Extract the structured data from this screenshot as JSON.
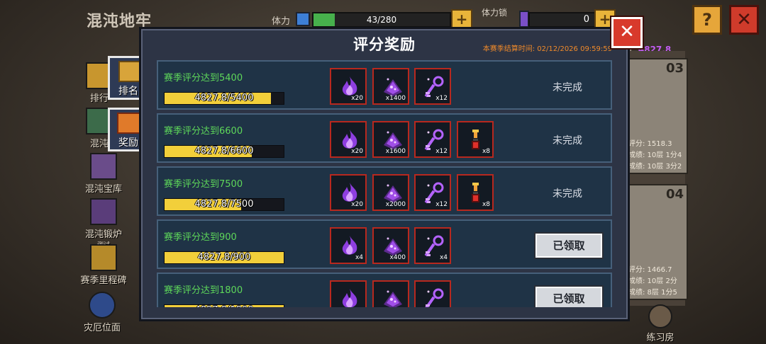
{
  "background": {
    "title": "混沌地牢",
    "stamina_label": "体力",
    "stamina_value": "43/280",
    "stamina_fraction": 0.154,
    "lock_label": "体力锁",
    "lock_value": "0",
    "help_label": "?",
    "close_label": "✕"
  },
  "sidebar": {
    "items": [
      {
        "label": "排行",
        "icon": "trophy-icon"
      },
      {
        "label": "混沌",
        "icon": "portal-icon"
      },
      {
        "label": "混沌宝库",
        "icon": "vault-icon"
      },
      {
        "label": "混沌锻炉",
        "sublabel": "测试",
        "icon": "forge-icon"
      },
      {
        "label": "赛季里程碑",
        "icon": "star-badge-icon"
      },
      {
        "label": "灾厄位面",
        "icon": "vortex-icon"
      }
    ],
    "tabs": [
      {
        "label": "排名",
        "icon": "trophy-icon"
      },
      {
        "label": "奖励",
        "icon": "treasure-chest-icon"
      }
    ]
  },
  "right_panel": {
    "score_label": "分:",
    "score_value": "4827.8",
    "cards": [
      {
        "number": "03",
        "lines": [
          "评分: 1518.3",
          "成绩: 10层 1分4",
          "成绩: 10层 3分2"
        ]
      },
      {
        "number": "04",
        "lines": [
          "评分: 1466.7",
          "成绩: 10层 2分",
          "成绩: 8层 1分5"
        ]
      }
    ],
    "practice_label": "练习房"
  },
  "modal": {
    "title": "评分奖励",
    "season_end": "本赛季结算时间: 02/12/2026 09:59:59",
    "close_label": "✕",
    "rows": [
      {
        "label": "赛季评分达到5400",
        "progress_text": "4827.8/5400",
        "progress": 0.894,
        "rewards": [
          {
            "icon": "purple-flame-icon",
            "qty": "x20"
          },
          {
            "icon": "purple-dust-pile-icon",
            "qty": "x1400"
          },
          {
            "icon": "purple-key-icon",
            "qty": "x12"
          }
        ],
        "status": "未完成",
        "claimed": false
      },
      {
        "label": "赛季评分达到6600",
        "progress_text": "4827.8/6600",
        "progress": 0.731,
        "rewards": [
          {
            "icon": "purple-flame-icon",
            "qty": "x20"
          },
          {
            "icon": "purple-dust-pile-icon",
            "qty": "x1600"
          },
          {
            "icon": "purple-key-icon",
            "qty": "x12"
          },
          {
            "icon": "torch-potion-icon",
            "qty": "x8"
          }
        ],
        "status": "未完成",
        "claimed": false
      },
      {
        "label": "赛季评分达到7500",
        "progress_text": "4827.8/7500",
        "progress": 0.644,
        "rewards": [
          {
            "icon": "purple-flame-icon",
            "qty": "x20"
          },
          {
            "icon": "purple-dust-pile-icon",
            "qty": "x2000"
          },
          {
            "icon": "purple-key-icon",
            "qty": "x12"
          },
          {
            "icon": "torch-potion-icon",
            "qty": "x8"
          }
        ],
        "status": "未完成",
        "claimed": false
      },
      {
        "label": "赛季评分达到900",
        "progress_text": "4827.8/900",
        "progress": 1.0,
        "rewards": [
          {
            "icon": "purple-flame-icon",
            "qty": "x4"
          },
          {
            "icon": "purple-dust-pile-icon",
            "qty": "x400"
          },
          {
            "icon": "purple-key-icon",
            "qty": "x4"
          }
        ],
        "status": "已领取",
        "claimed": true
      },
      {
        "label": "赛季评分达到1800",
        "progress_text": "4827.8/1800",
        "progress": 1.0,
        "rewards": [
          {
            "icon": "purple-flame-icon",
            "qty": ""
          },
          {
            "icon": "purple-dust-pile-icon",
            "qty": ""
          },
          {
            "icon": "purple-key-icon",
            "qty": ""
          }
        ],
        "status": "已领取",
        "claimed": true
      }
    ]
  },
  "colors": {
    "accent_green": "#5ed85a",
    "progress_yellow": "#f2cf3a",
    "reward_border": "#b8281e",
    "season_orange": "#f08a2a"
  }
}
